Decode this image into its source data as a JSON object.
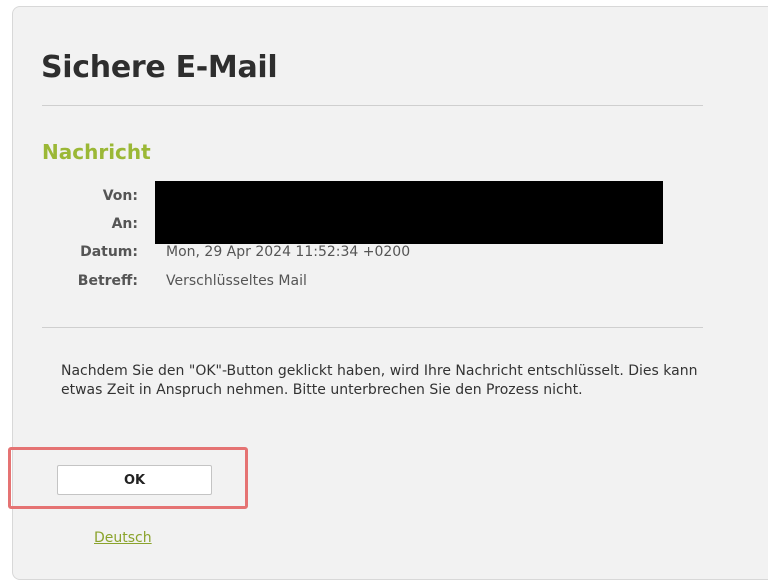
{
  "page": {
    "title": "Sichere E-Mail"
  },
  "message": {
    "heading": "Nachricht",
    "fields": {
      "from": {
        "label": "Von:",
        "value": ""
      },
      "to": {
        "label": "An:",
        "value": ""
      },
      "date": {
        "label": "Datum:",
        "value": "Mon, 29 Apr 2024 11:52:34 +0200"
      },
      "subject": {
        "label": "Betreff:",
        "value": "Verschlüsseltes Mail"
      }
    }
  },
  "instructions": "Nachdem Sie den \"OK\"-Button geklickt haben, wird Ihre Nachricht entschlüsselt. Dies kann etwas Zeit in Anspruch nehmen. Bitte unterbrechen Sie den Prozess nicht.",
  "actions": {
    "ok_label": "OK"
  },
  "language": {
    "link_label": "Deutsch"
  },
  "colors": {
    "accent": "#9bb836",
    "link": "#8aa32c",
    "highlight_border": "#e57373",
    "panel_background": "#f2f2f2",
    "redaction": "#000000"
  }
}
